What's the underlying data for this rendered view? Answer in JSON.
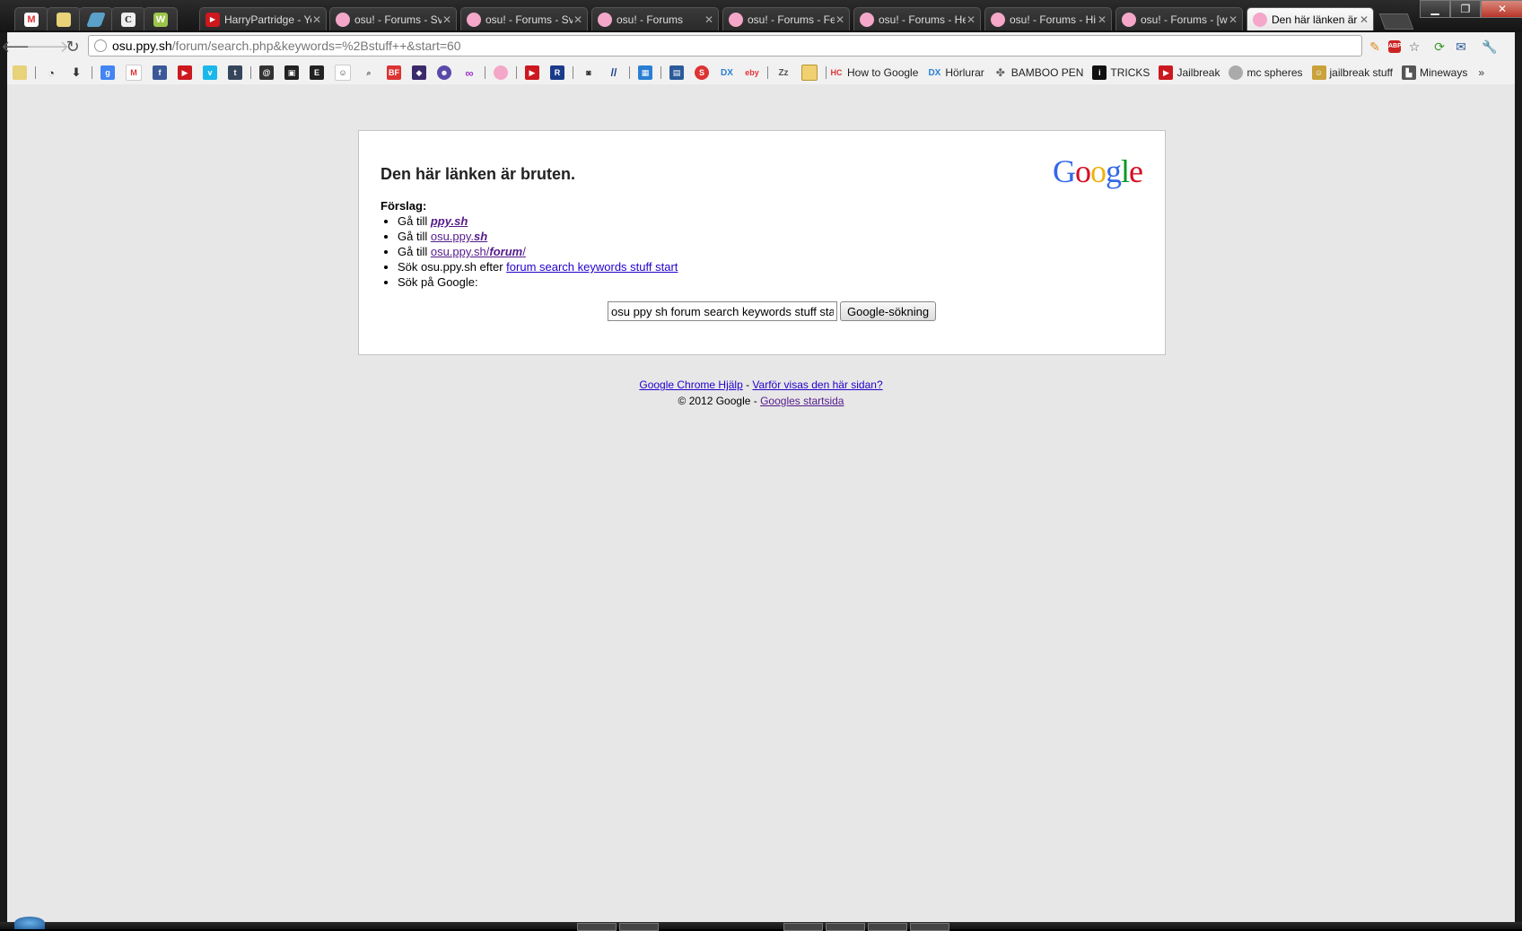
{
  "tabs": [
    {
      "title": "",
      "icon": "gmail-icon",
      "pinned": true
    },
    {
      "title": "",
      "icon": "notes-icon",
      "pinned": true
    },
    {
      "title": "",
      "icon": "parallelogram-icon",
      "pinned": true
    },
    {
      "title": "",
      "icon": "c-logo-icon",
      "pinned": true
    },
    {
      "title": "",
      "icon": "w-logo-icon",
      "pinned": true
    },
    {
      "title": "HarryPartridge - Yo",
      "icon": "youtube-icon"
    },
    {
      "title": "osu! - Forums - Sv",
      "icon": "osu-icon"
    },
    {
      "title": "osu! - Forums - Sv",
      "icon": "osu-icon"
    },
    {
      "title": "osu! - Forums",
      "icon": "osu-icon"
    },
    {
      "title": "osu! - Forums - Fe",
      "icon": "osu-icon"
    },
    {
      "title": "osu! - Forums - He",
      "icon": "osu-icon"
    },
    {
      "title": "osu! - Forums - Hi",
      "icon": "osu-icon"
    },
    {
      "title": "osu! - Forums - [w",
      "icon": "osu-icon"
    },
    {
      "title": "Den här länken är b",
      "icon": "osu-icon",
      "active": true
    }
  ],
  "address": {
    "host": "osu.ppy.sh",
    "path": "/forum/search.php&keywords=%2Bstuff++&start=60"
  },
  "bookmarks": [
    {
      "label": "How to Google",
      "icon": "hc-icon",
      "color": "#d33"
    },
    {
      "label": "Hörlurar",
      "icon": "dx-icon",
      "color": "#2a7fd4"
    },
    {
      "label": "BAMBOO PEN",
      "icon": "puzzle-icon",
      "color": "#666"
    },
    {
      "label": "TRICKS",
      "icon": "info-icon",
      "color": "#111"
    },
    {
      "label": "Jailbreak",
      "icon": "youtube-icon",
      "color": "#cc181e"
    },
    {
      "label": "mc spheres",
      "icon": "globe-icon",
      "color": "#888"
    },
    {
      "label": "jailbreak stuff",
      "icon": "person-icon",
      "color": "#c9a23a"
    },
    {
      "label": "Mineways",
      "icon": "building-icon",
      "color": "#555"
    }
  ],
  "page": {
    "heading": "Den här länken är bruten.",
    "logo": "Google",
    "suggestions_title": "Förslag:",
    "s1_prefix": "Gå till ",
    "s1_link": "ppy.sh",
    "s2_prefix": "Gå till ",
    "s2_link_a": "osu.ppy.",
    "s2_link_b": "sh",
    "s3_prefix": "Gå till ",
    "s3_link_a": "osu.ppy.sh/",
    "s3_link_b": "forum",
    "s3_link_c": "/",
    "s4_prefix": "Sök osu.ppy.sh efter ",
    "s4_link": "forum search keywords stuff start",
    "s5_text": "Sök på Google:",
    "search_value": "osu ppy sh forum search keywords stuff start",
    "search_button": "Google-sökning"
  },
  "footer": {
    "help_link": "Google Chrome Hjälp",
    "sep": " - ",
    "why_link": "Varför visas den här sidan?",
    "copyright": "© 2012 Google - ",
    "home_link": "Googles startsida"
  }
}
